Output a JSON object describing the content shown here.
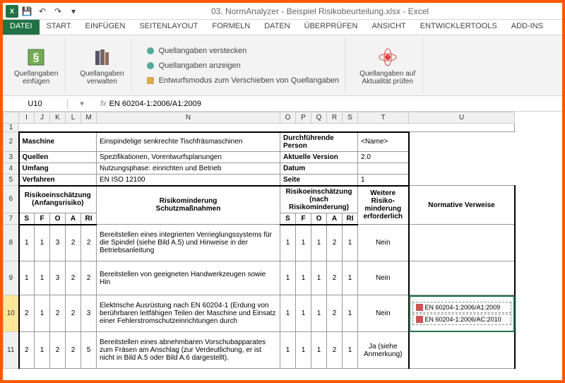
{
  "title": "03. NormAnalyzer - Beispiel Risikobeurteilung.xlsx - Excel",
  "qat": {
    "excel": "X",
    "save": "💾",
    "undo": "↶",
    "redo": "↷",
    "drop": "▾"
  },
  "menu": {
    "tabs": [
      "DATEI",
      "START",
      "EINFÜGEN",
      "SEITENLAYOUT",
      "FORMELN",
      "DATEN",
      "ÜBERPRÜFEN",
      "ANSICHT",
      "ENTWICKLERTOOLS",
      "ADD-INS"
    ]
  },
  "ribbon": {
    "insert": "Quellangaben\neinfügen",
    "manage": "Quellangaben\nverwalten",
    "hide": "Quellangaben verstecken",
    "show": "Quellangaben anzeigen",
    "draft": "Entwurfsmodus zum Verschieben von Quellangaben",
    "check": "Quellangaben auf\nAktualität prüfen"
  },
  "formula": {
    "cell": "U10",
    "fx": "fx",
    "value": "EN 60204-1:2006/A1:2009"
  },
  "cols": [
    "I",
    "J",
    "K",
    "L",
    "M",
    "N",
    "O",
    "P",
    "Q",
    "R",
    "S",
    "T",
    "U"
  ],
  "rownums": [
    "1",
    "2",
    "3",
    "4",
    "5",
    "6",
    "7",
    "8",
    "9",
    "10",
    "11"
  ],
  "meta": {
    "r2": {
      "label": "Maschine",
      "val": "Einspindelige senkrechte Tischfräsmaschinen",
      "p": "Durchführende Person",
      "pv": "<Name>"
    },
    "r3": {
      "label": "Quellen",
      "val": "Spezifikationen, Vorentwurfsplanungen",
      "p": "Aktuelle Version",
      "pv": "2.0"
    },
    "r4": {
      "label": "Umfang",
      "val": "Nutzungsphase: einrichten und Betrieb",
      "p": "Datum",
      "pv": ""
    },
    "r5": {
      "label": "Verfahren",
      "val": "EN ISO 12100",
      "p": "Seite",
      "pv": "1"
    }
  },
  "hdr": {
    "risk_before": "Risikoeinschätzung\n(Anfangsrisiko)",
    "mitigation": "Risikominderung\nSchutzmaßnahmen",
    "risk_after": "Risikoeinschätzung\n(nach Risikominderung)",
    "further": "Weitere\nRisiko-\nminderung\nerforderlich",
    "refs": "Normative Verweise",
    "S": "S",
    "F": "F",
    "O": "O",
    "A": "A",
    "RI": "RI"
  },
  "rows": [
    {
      "b": [
        "1",
        "1",
        "3",
        "2",
        "2"
      ],
      "txt": "Bereitstellen eines integrierten Verrieglungssystems für die Spindel (siehe Bild A.5) und Hinweise in der Betriebsanleitung",
      "a": [
        "1",
        "1",
        "1",
        "2",
        "1"
      ],
      "further": "Nein",
      "ref": []
    },
    {
      "b": [
        "1",
        "1",
        "3",
        "2",
        "2"
      ],
      "txt": "Bereitstellen von geeigneten Handwerkzeugen sowie Hin",
      "a": [
        "1",
        "1",
        "1",
        "2",
        "1"
      ],
      "further": "Nein",
      "ref": []
    },
    {
      "b": [
        "2",
        "1",
        "2",
        "2",
        "3"
      ],
      "txt": "Elektrische Ausrüstung nach EN 60204-1 (Erdung von berührbaren leitfähigen Teilen der Maschine und Einsatz einer Fehlerstromschutzeinrichtungen durch",
      "a": [
        "1",
        "1",
        "1",
        "2",
        "1"
      ],
      "further": "Nein",
      "ref": [
        "EN 60204-1:2006/A1:2009",
        "EN 60204-1:2006/AC:2010"
      ]
    },
    {
      "b": [
        "2",
        "1",
        "2",
        "2",
        "5"
      ],
      "txt": "Bereitstellen eines abnehmbaren Vorschubapparates zum Fräsen am Anschlag (zur Verdeutlichung, er ist nicht in Bild A.5 oder Bild A.6 dargestellt).",
      "a": [
        "1",
        "1",
        "1",
        "2",
        "1"
      ],
      "further": "Ja (siehe Anmerkung)",
      "ref": []
    }
  ]
}
